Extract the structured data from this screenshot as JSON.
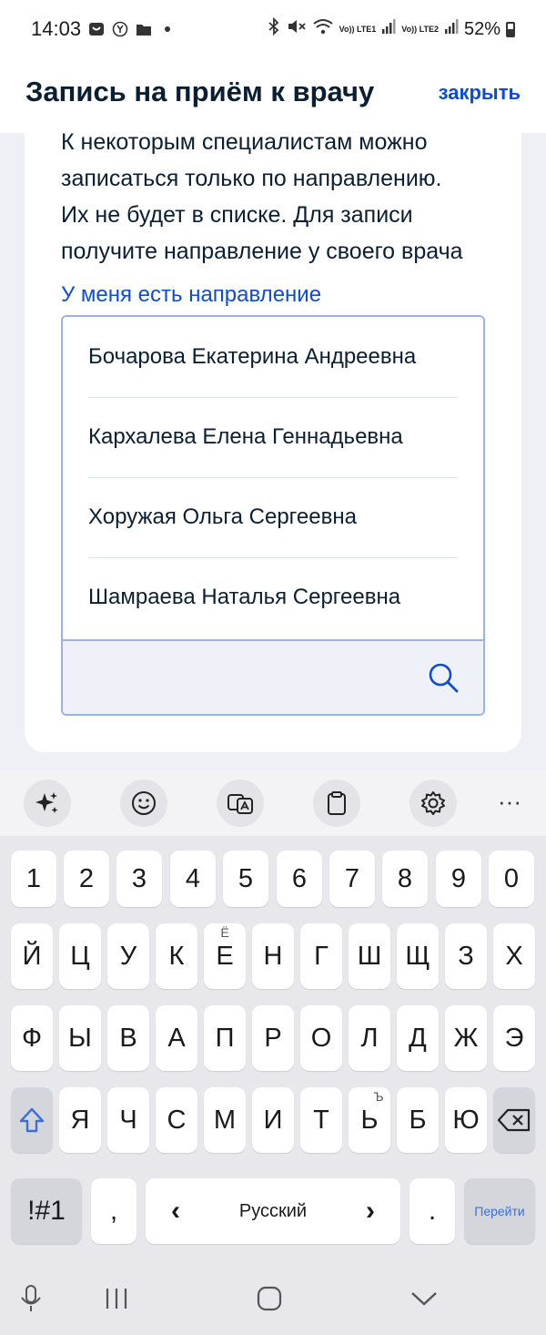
{
  "status_bar": {
    "time": "14:03",
    "battery": "52%",
    "icons": [
      "shopping-bag-icon",
      "yandex-icon",
      "folder-icon",
      "dot-icon",
      "bluetooth-icon",
      "mute-icon",
      "wifi-icon",
      "volte1-icon",
      "signal-icon",
      "volte2-icon",
      "signal-icon",
      "battery-icon"
    ],
    "volte1": "Vo)) LTE1",
    "volte2": "Vo)) LTE2"
  },
  "header": {
    "title": "Запись на приём к врачу",
    "close_label": "закрыть"
  },
  "content": {
    "info_lines": [
      "К некоторым специалистам можно",
      "записаться только по направлению.",
      "Их не будет в списке. Для записи",
      "получите направление у своего врача"
    ],
    "referral_link": "У меня есть направление",
    "doctors": [
      "Бочарова Екатерина Андреевна",
      "Кархалева Елена Геннадьевна",
      "Хоружая Ольга Сергеевна",
      "Шамраева Наталья Сергеевна"
    ],
    "search": {
      "value": "",
      "placeholder": ""
    }
  },
  "keyboard": {
    "toolbar": [
      "sparkle-icon",
      "emoji-icon",
      "translate-icon",
      "clipboard-icon",
      "settings-icon",
      "more-icon"
    ],
    "more_label": "···",
    "row_numbers": [
      "1",
      "2",
      "3",
      "4",
      "5",
      "6",
      "7",
      "8",
      "9",
      "0"
    ],
    "row1": [
      "Й",
      "Ц",
      "У",
      "К",
      "Е",
      "Н",
      "Г",
      "Ш",
      "Щ",
      "З",
      "Х"
    ],
    "row1_hint_e": "Ё",
    "row2": [
      "Ф",
      "Ы",
      "В",
      "А",
      "П",
      "Р",
      "О",
      "Л",
      "Д",
      "Ж",
      "Э"
    ],
    "row3": [
      "Я",
      "Ч",
      "С",
      "М",
      "И",
      "Т",
      "Ь",
      "Б",
      "Ю"
    ],
    "row3_hint_soft": "Ъ",
    "symbols_label": "!#1",
    "comma_label": ",",
    "space_label": "Русский",
    "left_arrow": "‹",
    "right_arrow": "›",
    "period_label": ".",
    "go_label": "Перейти"
  },
  "colors": {
    "accent": "#0d4cd3",
    "title": "#0b1f33",
    "border": "#9bb3e3",
    "background": "#eef0f5"
  }
}
